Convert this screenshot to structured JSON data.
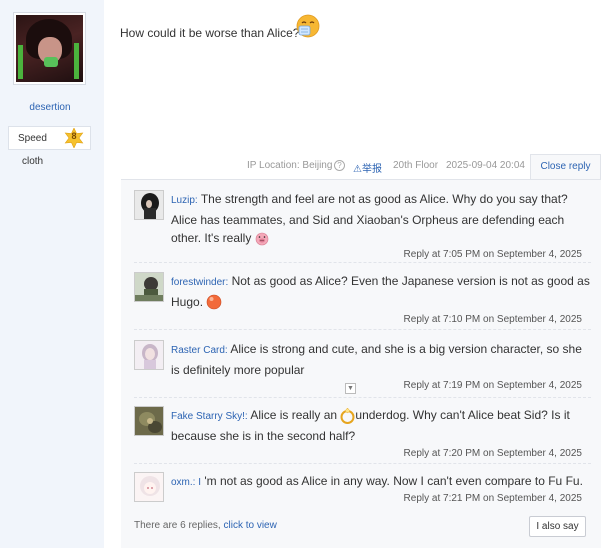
{
  "author": {
    "username": "desertion",
    "badge_label": "Speed",
    "level": "8",
    "rank_title": "cloth"
  },
  "post": {
    "text": "How could it be worse than Alice?",
    "emoji": "sneeze-emoji"
  },
  "meta": {
    "ip_location": "IP Location: Beijing",
    "help_icon_glyph": "?",
    "report_label": "⚠举报",
    "floor": "20th Floor",
    "datetime": "2025-09-04 20:04",
    "close_reply_label": "Close reply"
  },
  "replies": [
    {
      "username": "Luzip",
      "separator": ":",
      "text": "The strength and feel are not as good as Alice. Why do you say that? Alice has teammates, and Sid and Xiaoban's Orpheus are defending each other. It's really",
      "trailing_emoji": "pig-face-emoji",
      "reply_at": "Reply at 7:05 PM on September 4, 2025"
    },
    {
      "username": "forestwinder",
      "separator": ":",
      "text": "Not as good as Alice? Even the Japanese version is not as good as Hugo.",
      "trailing_emoji": "orange-ball-emoji",
      "reply_at": "Reply at 7:10 PM on September 4, 2025"
    },
    {
      "username": "Raster Card",
      "separator": ":",
      "text": "Alice is strong and cute, and she is a big version character, so she is definitely more popular",
      "reply_at": "Reply at 7:19 PM on September 4, 2025"
    },
    {
      "username": "Fake Starry Sky!",
      "separator": ":",
      "text_before": "Alice is really an",
      "inline_emoji": "gold-ring-emoji",
      "text_after": "underdog. Why can't Alice beat Sid? Is it because she is in the second half?",
      "reply_at": "Reply at 7:20 PM on September 4, 2025"
    },
    {
      "username": "oxm.: I",
      "separator": "",
      "text": "'m not as good as Alice in any way. Now I can't even compare to Fu Fu.",
      "reply_at": "Reply at 7:21 PM on September 4, 2025"
    }
  ],
  "footer": {
    "summary": "There are 6 replies,",
    "view_link": "click to view",
    "also_say_label": "I also say"
  },
  "colors": {
    "link": "#2d64b3",
    "sidebar_bg": "#f1f5fb",
    "reply_bg": "#f7f8fa",
    "badge_gold": "#f5c12e"
  }
}
